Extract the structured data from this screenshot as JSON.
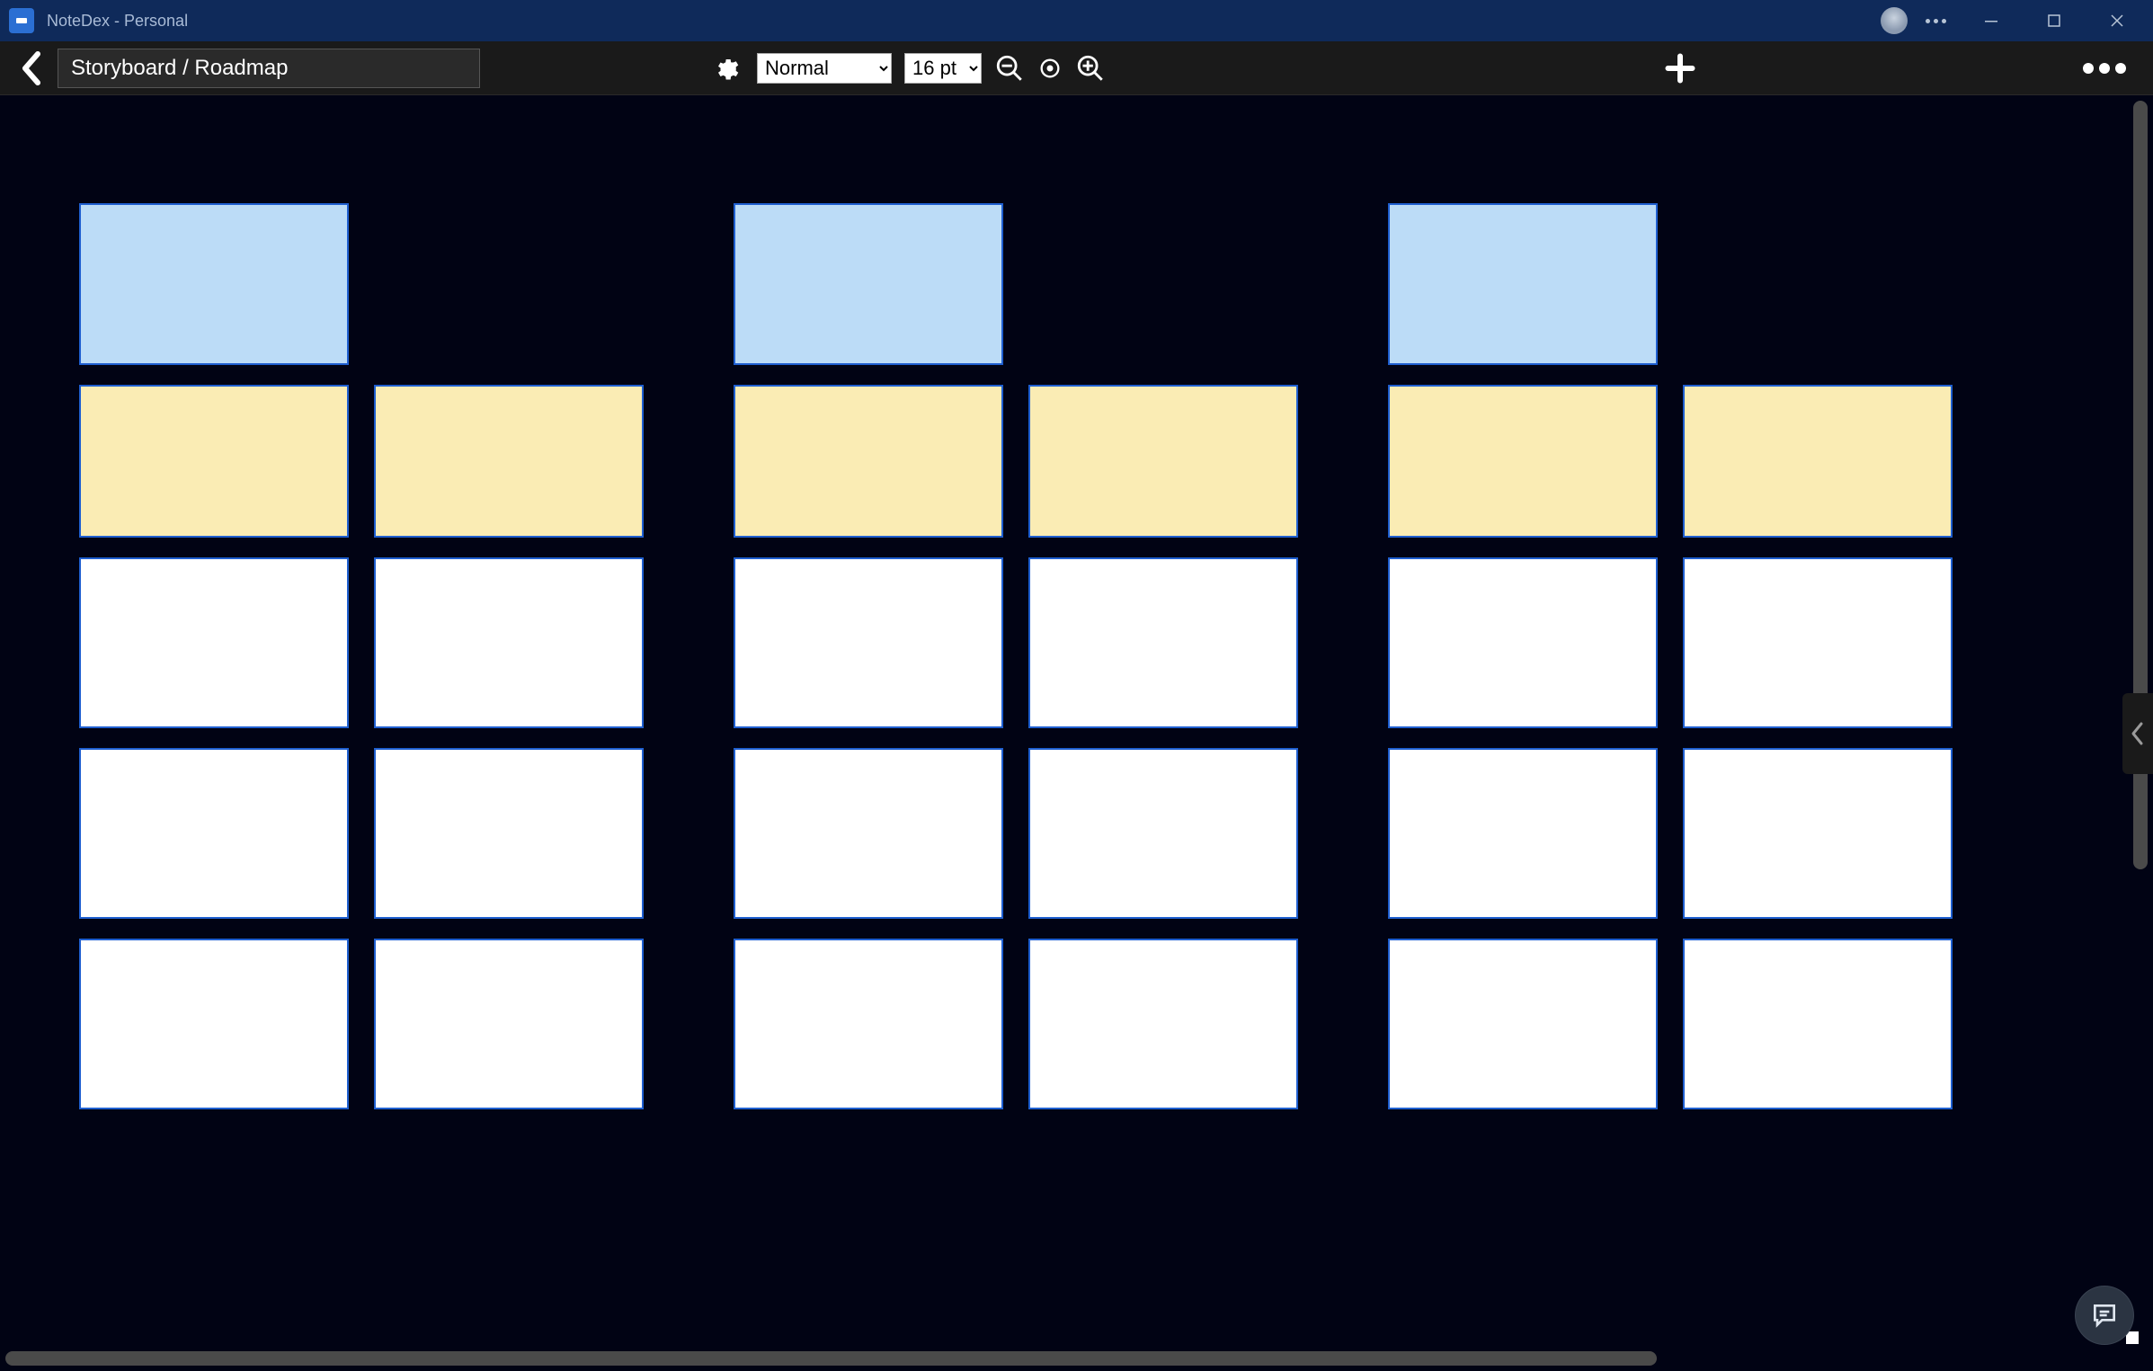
{
  "titlebar": {
    "app_title": "NoteDex - Personal"
  },
  "toolbar": {
    "title_value": "Storyboard / Roadmap",
    "style_selected": "Normal",
    "style_options": [
      "Normal"
    ],
    "size_selected": "16 pt",
    "size_options": [
      "16 pt"
    ]
  },
  "colors": {
    "header_card": "#bcdcf7",
    "yellow_card": "#faecb4",
    "white_card": "#ffffff",
    "card_border": "#1f5fd0",
    "canvas_bg": "#010314"
  },
  "groups": [
    {
      "id": "group-1",
      "rows": [
        [
          "header",
          "empty"
        ],
        [
          "yellow",
          "yellow"
        ],
        [
          "white",
          "white"
        ],
        [
          "white",
          "white"
        ],
        [
          "white",
          "white"
        ]
      ]
    },
    {
      "id": "group-2",
      "rows": [
        [
          "header",
          "empty"
        ],
        [
          "yellow",
          "yellow"
        ],
        [
          "white",
          "white"
        ],
        [
          "white",
          "white"
        ],
        [
          "white",
          "white"
        ]
      ]
    },
    {
      "id": "group-3",
      "rows": [
        [
          "header",
          "empty"
        ],
        [
          "yellow",
          "yellow"
        ],
        [
          "white",
          "white"
        ],
        [
          "white",
          "white"
        ],
        [
          "white",
          "white"
        ]
      ]
    }
  ]
}
